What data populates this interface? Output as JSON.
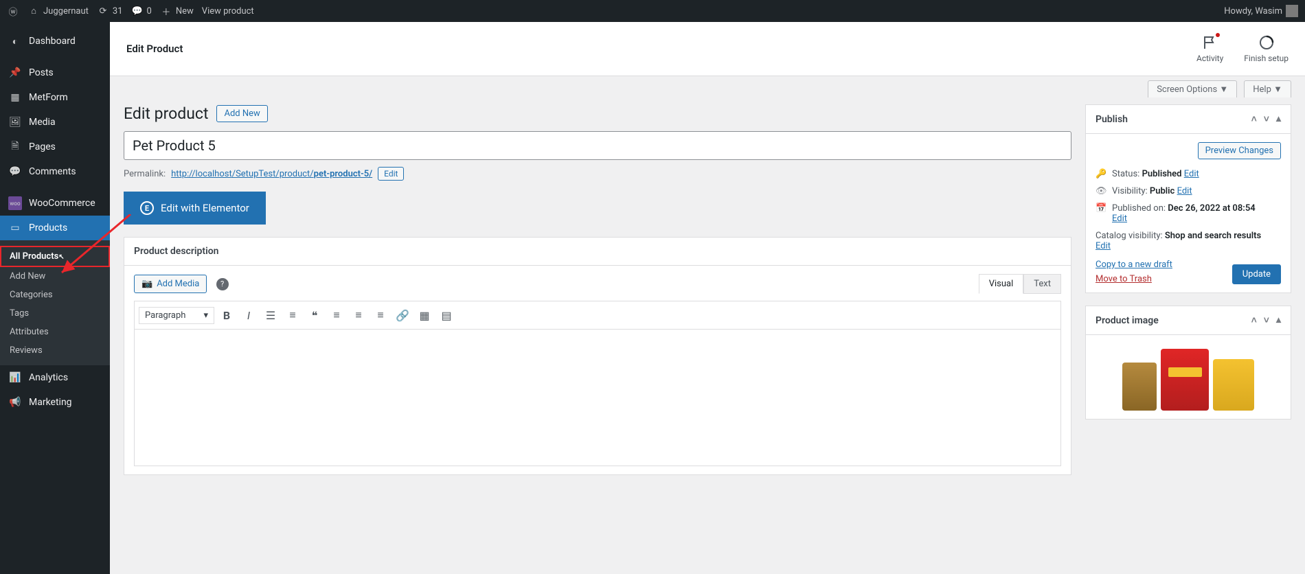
{
  "topbar": {
    "site_name": "Juggernaut",
    "updates_count": "31",
    "comments_count": "0",
    "new_label": "New",
    "view_product": "View product",
    "howdy": "Howdy, Wasim"
  },
  "sidebar": {
    "dashboard": "Dashboard",
    "posts": "Posts",
    "metform": "MetForm",
    "media": "Media",
    "pages": "Pages",
    "comments": "Comments",
    "woocommerce": "WooCommerce",
    "products": "Products",
    "analytics": "Analytics",
    "marketing": "Marketing",
    "sub": {
      "all_products": "All Products",
      "add_new": "Add New",
      "categories": "Categories",
      "tags": "Tags",
      "attributes": "Attributes",
      "reviews": "Reviews"
    }
  },
  "header": {
    "title": "Edit Product",
    "activity": "Activity",
    "finish_setup": "Finish setup"
  },
  "tabs": {
    "screen_options": "Screen Options",
    "help": "Help"
  },
  "product": {
    "heading": "Edit product",
    "add_new": "Add New",
    "title_value": "Pet Product 5",
    "permalink_label": "Permalink:",
    "permalink_base": "http://localhost/SetupTest/product/",
    "permalink_slug": "pet-product-5/",
    "permalink_edit": "Edit",
    "elementor_btn": "Edit with Elementor",
    "description_heading": "Product description",
    "add_media": "Add Media",
    "visual_tab": "Visual",
    "text_tab": "Text",
    "paragraph": "Paragraph"
  },
  "publish": {
    "title": "Publish",
    "preview": "Preview Changes",
    "status_label": "Status:",
    "status_value": "Published",
    "edit": "Edit",
    "visibility_label": "Visibility:",
    "visibility_value": "Public",
    "published_label": "Published on:",
    "published_value": "Dec 26, 2022 at 08:54",
    "catalog_label": "Catalog visibility:",
    "catalog_value": "Shop and search results",
    "copy_draft": "Copy to a new draft",
    "move_trash": "Move to Trash",
    "update": "Update"
  },
  "product_image": {
    "title": "Product image"
  }
}
